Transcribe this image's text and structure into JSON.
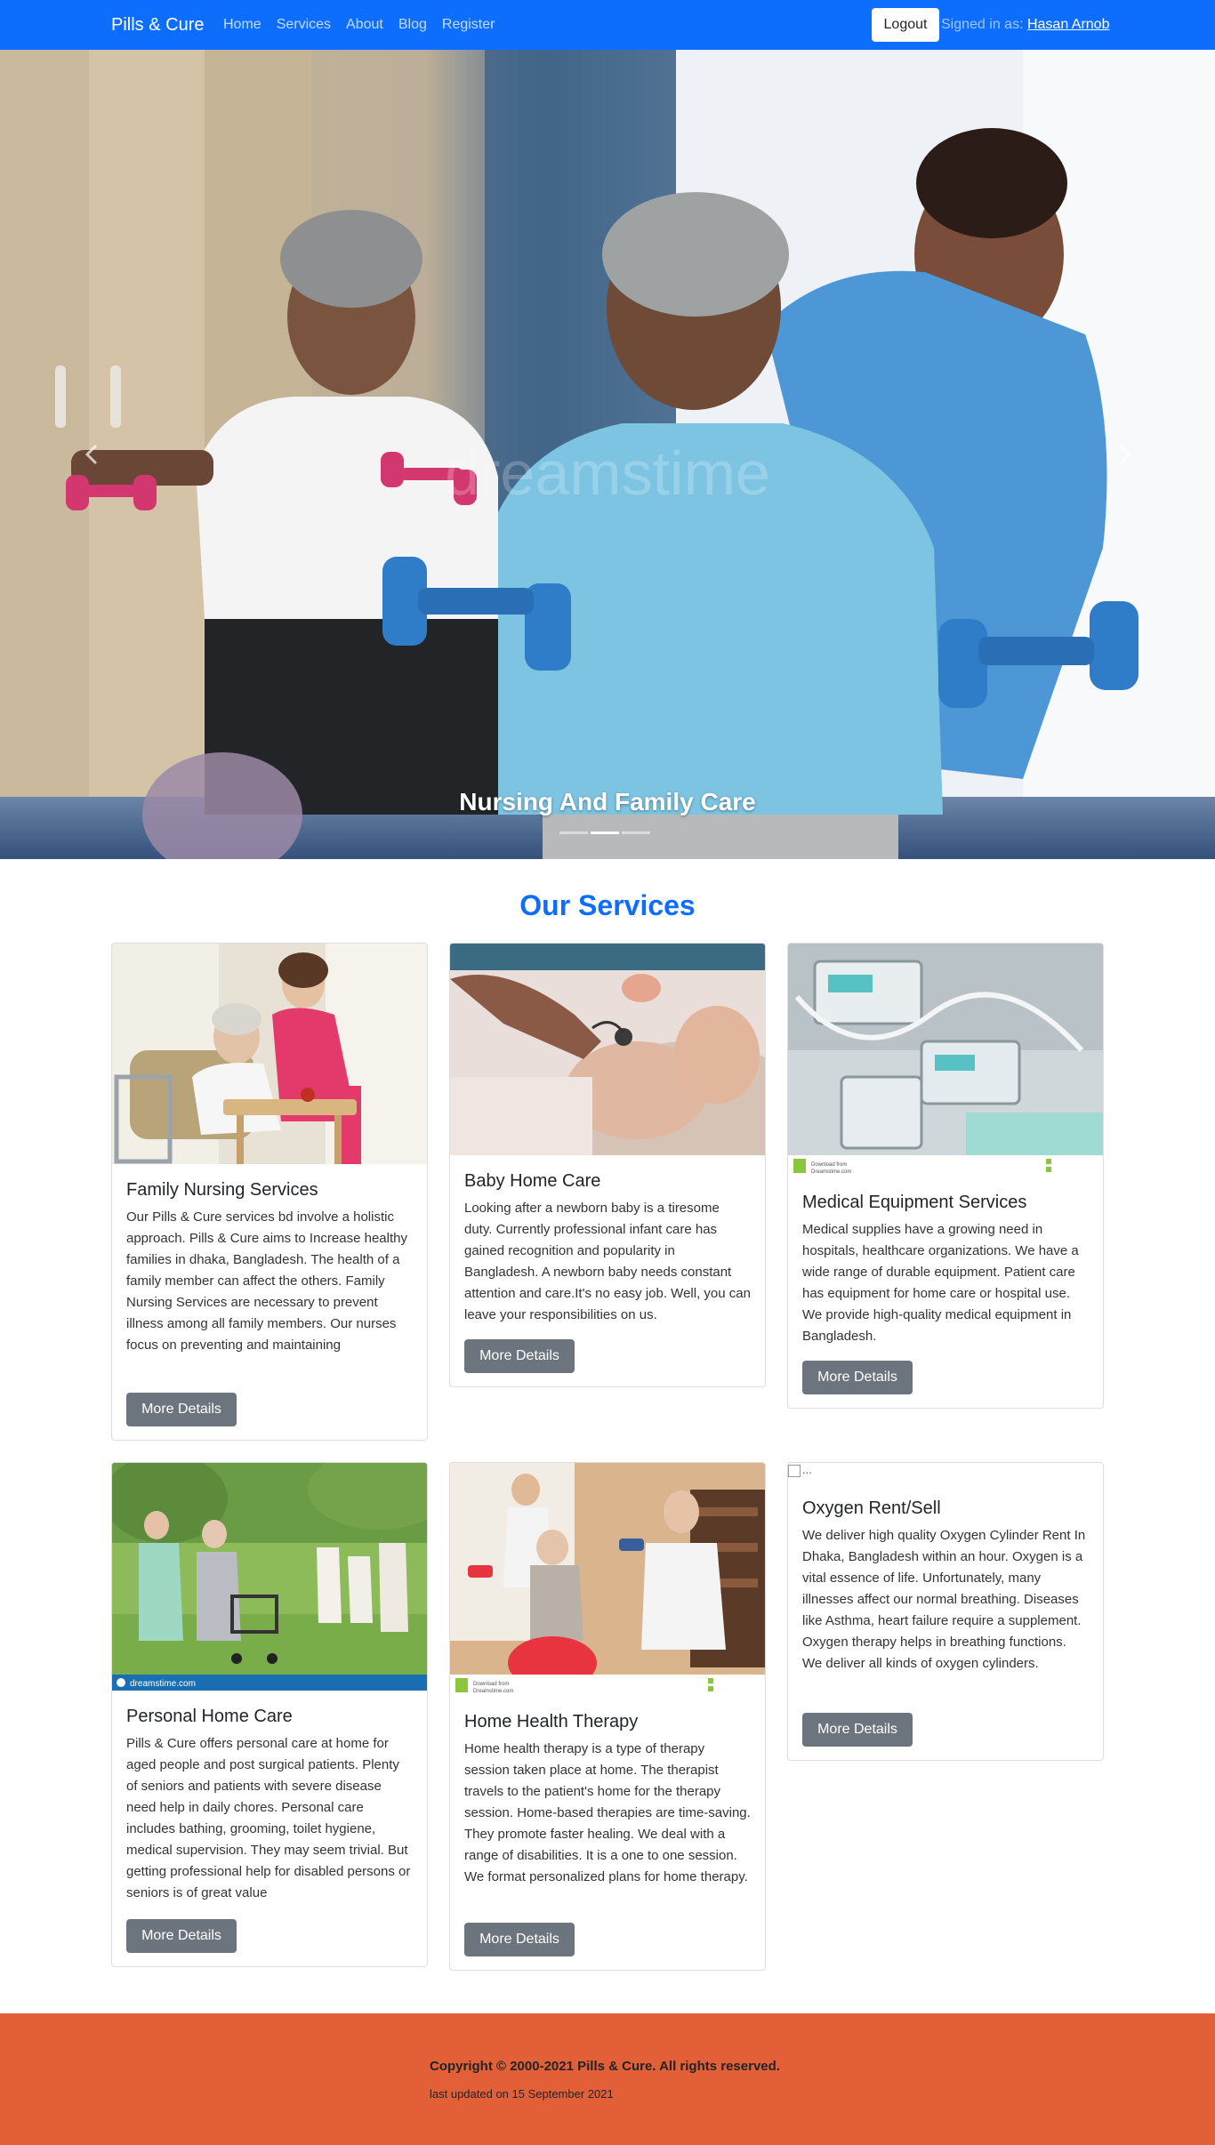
{
  "navbar": {
    "brand": "Pills & Cure",
    "links": [
      "Home",
      "Services",
      "About",
      "Blog",
      "Register"
    ],
    "logout_label": "Logout",
    "signed_in_prefix": "Signed in as:",
    "user_name": "Hasan Arnob",
    "color": "#0d6efd"
  },
  "carousel": {
    "caption": "Nursing And Family Care",
    "indicator_count": 3,
    "active_indicator": 2
  },
  "services": {
    "title": "Our Services",
    "button_label": "More Details",
    "cards": [
      {
        "title": "Family Nursing Services",
        "text": "Our Pills & Cure services bd involve a holistic approach. Pills & Cure aims to Increase healthy families in dhaka, Bangladesh. The health of a family member can affect the others. Family Nursing Services are necessary to prevent illness among all family members. Our nurses focus on preventing and maintaining"
      },
      {
        "title": "Baby Home Care",
        "text": "Looking after a newborn baby is a tiresome duty. Currently professional infant care has gained recognition and popularity in Bangladesh. A newborn baby needs constant attention and care.It's no easy job. Well, you can leave your responsibilities on us."
      },
      {
        "title": "Medical Equipment Services",
        "text": "Medical supplies have a growing need in hospitals, healthcare organizations. We have a wide range of durable equipment. Patient care has equipment for home care or hospital use. We provide high-quality medical equipment in Bangladesh."
      },
      {
        "title": "Personal Home Care",
        "text": "Pills & Cure offers personal care at home for aged people and post surgical patients. Plenty of seniors and patients with severe disease need help in daily chores. Personal care includes bathing, grooming, toilet hygiene, medical supervision. They may seem trivial. But getting professional help for disabled persons or seniors is of great value"
      },
      {
        "title": "Home Health Therapy",
        "text": "Home health therapy is a type of therapy session taken place at home. The therapist travels to the patient's home for the therapy session. Home-based therapies are time-saving. They promote faster healing. We deal with a range of disabilities. It is a one to one session. We format personalized plans for home therapy."
      },
      {
        "title": "Oxygen Rent/Sell",
        "text": "We deliver high quality Oxygen Cylinder Rent In Dhaka, Bangladesh within an hour. Oxygen is a vital essence of life. Unfortunately, many illnesses affect our normal breathing. Diseases like Asthma, heart failure require a supplement. Oxygen therapy helps in breathing functions. We deliver all kinds of oxygen cylinders.",
        "broken_image_alt": "..."
      }
    ],
    "watermark_text": "Download from Dreamstime.com",
    "watermark_brand": "dreamstime.com"
  },
  "footer": {
    "copyright": "Copyright © 2000-2021 Pills & Cure. All rights reserved.",
    "updated": "last updated on 15 September 2021",
    "color": "#e35f37"
  }
}
